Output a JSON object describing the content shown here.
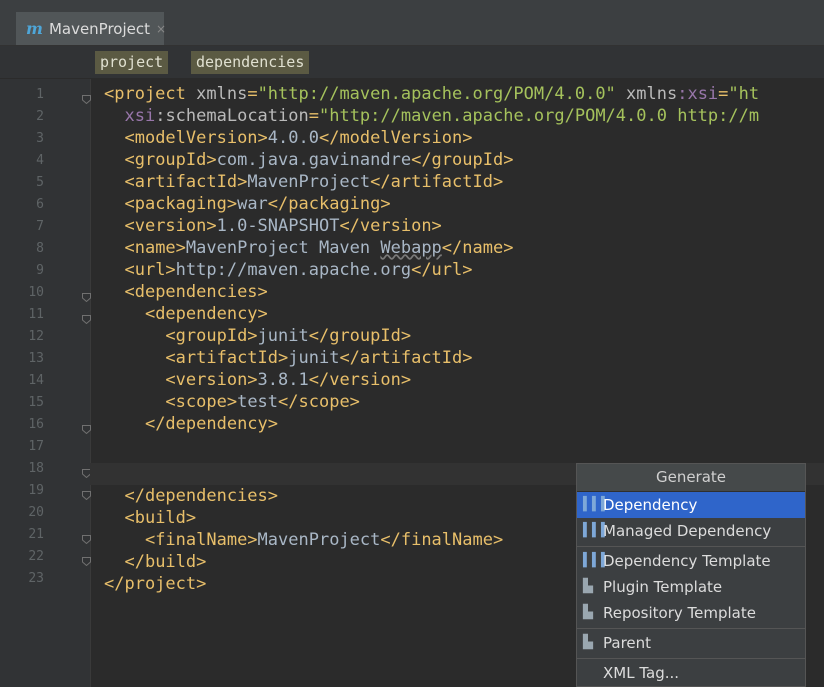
{
  "tab": {
    "icon": "m",
    "title": "MavenProject",
    "close": "×"
  },
  "breadcrumb": [
    "project",
    "dependencies"
  ],
  "line_numbers": [
    "1",
    "2",
    "3",
    "4",
    "5",
    "6",
    "7",
    "8",
    "9",
    "10",
    "11",
    "12",
    "13",
    "14",
    "15",
    "16",
    "17",
    "18",
    "19",
    "20",
    "21",
    "22",
    "23"
  ],
  "code": {
    "l1": {
      "open": "<project",
      "a1": " xmlns",
      "eq": "=",
      "v1": "\"http://maven.apache.org/POM/4.0.0\"",
      "a2": " xmlns",
      "ns": ":xsi",
      "eq2": "=",
      "v2": "\"ht"
    },
    "l2": {
      "ns": "xsi",
      "attr": ":schemaLocation",
      "eq": "=",
      "val": "\"http://maven.apache.org/POM/4.0.0 http://m"
    },
    "l3": {
      "o": "<modelVersion>",
      "t": "4.0.0",
      "c": "</modelVersion>"
    },
    "l4": {
      "o": "<groupId>",
      "t": "com.java.gavinandre",
      "c": "</groupId>"
    },
    "l5": {
      "o": "<artifactId>",
      "t": "MavenProject",
      "c": "</artifactId>"
    },
    "l6": {
      "o": "<packaging>",
      "t": "war",
      "c": "</packaging>"
    },
    "l7": {
      "o": "<version>",
      "t": "1.0-SNAPSHOT",
      "c": "</version>"
    },
    "l8": {
      "o": "<name>",
      "t": "MavenProject Maven ",
      "t2": "Webapp",
      "c": "</name>"
    },
    "l9": {
      "o": "<url>",
      "t": "http://maven.apache.org",
      "c": "</url>"
    },
    "l10": {
      "o": "<dependencies>"
    },
    "l11": {
      "o": "<dependency>"
    },
    "l12": {
      "o": "<groupId>",
      "t": "junit",
      "c": "</groupId>"
    },
    "l13": {
      "o": "<artifactId>",
      "t": "junit",
      "c": "</artifactId>"
    },
    "l14": {
      "o": "<version>",
      "t": "3.8.1",
      "c": "</version>"
    },
    "l15": {
      "o": "<scope>",
      "t": "test",
      "c": "</scope>"
    },
    "l16": {
      "c": "</dependency>"
    },
    "l18": {
      "c": "</dependencies>"
    },
    "l19": {
      "o": "<build>"
    },
    "l20": {
      "o": "<finalName>",
      "t": "MavenProject",
      "c": "</finalName>"
    },
    "l21": {
      "c": "</build>"
    },
    "l22": {
      "c": "</project>"
    }
  },
  "popup": {
    "title": "Generate",
    "items": [
      {
        "label": "Dependency",
        "icon": "maven-bars-icon"
      },
      {
        "label": "Managed Dependency",
        "icon": "maven-bars-icon"
      },
      {
        "label": "Dependency Template",
        "icon": "maven-bars-icon"
      },
      {
        "label": "Plugin Template",
        "icon": "maven-plugin-icon"
      },
      {
        "label": "Repository Template",
        "icon": "maven-plugin-icon"
      },
      {
        "label": "Parent",
        "icon": "maven-plugin-icon"
      },
      {
        "label": "XML Tag...",
        "icon": ""
      }
    ]
  },
  "colors": {
    "tag": "#e8bf6a",
    "value": "#a5c25c",
    "namespace": "#9876aa",
    "selection": "#2f65ca"
  }
}
